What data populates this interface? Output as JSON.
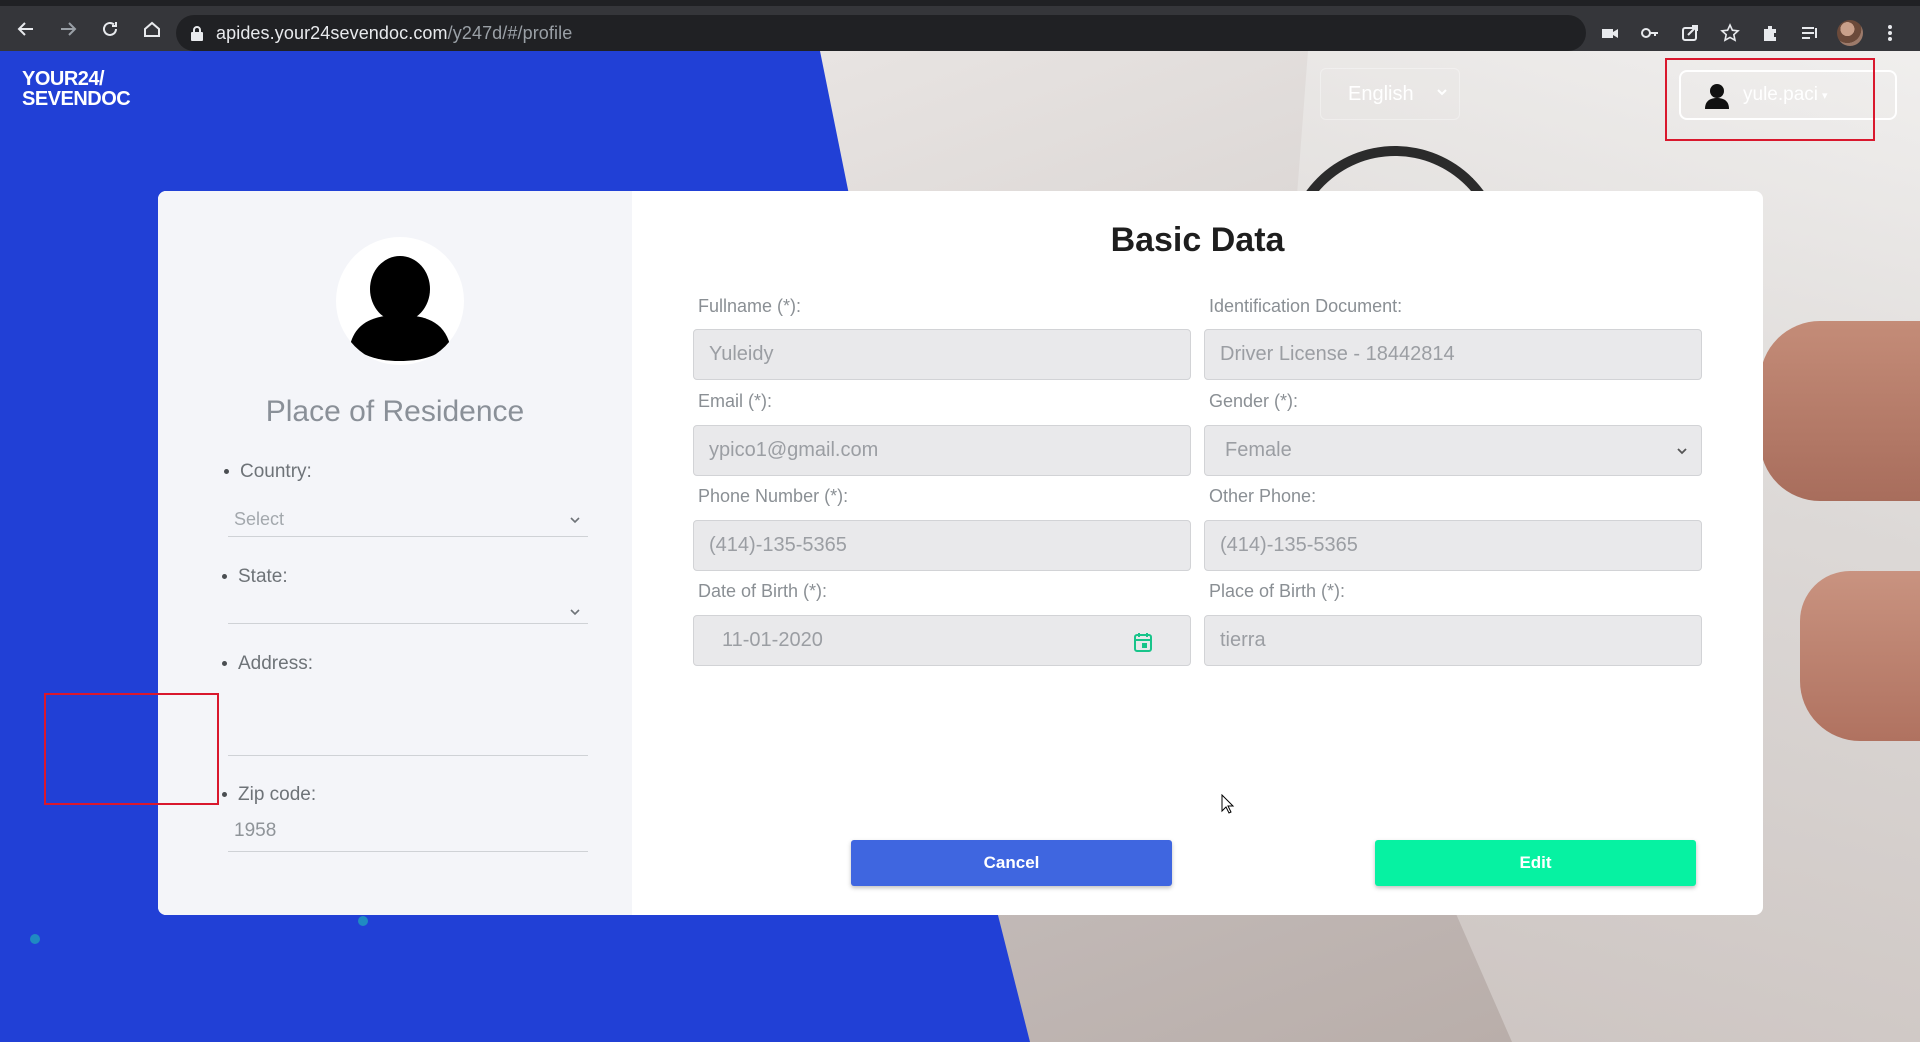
{
  "browser": {
    "url_domain": "apides.your24sevendoc.com",
    "url_path": "/y247d/#/profile"
  },
  "header": {
    "logo_line1": "YOUR24/",
    "logo_line2": "SEVENDOC",
    "language": "English",
    "username": "yule.paci"
  },
  "residence": {
    "title": "Place of Residence",
    "country_label": "Country:",
    "country_value": "Select",
    "state_label": "State:",
    "state_value": "",
    "address_label": "Address:",
    "address_value": "",
    "zip_label": "Zip code:",
    "zip_value": "1958"
  },
  "basic": {
    "title": "Basic Data",
    "fullname_label": "Fullname (*):",
    "fullname_value": "Yuleidy",
    "id_label": "Identification Document:",
    "id_value": "Driver License - 18442814",
    "email_label": "Email (*):",
    "email_value": "ypico1@gmail.com",
    "gender_label": "Gender (*):",
    "gender_value": "Female",
    "phone_label": "Phone Number (*):",
    "phone_value": "(414)-135-5365",
    "other_phone_label": "Other Phone:",
    "other_phone_value": "(414)-135-5365",
    "dob_label": "Date of Birth (*):",
    "dob_value": "11-01-2020",
    "pob_label": "Place of Birth (*):",
    "pob_value": "tierra"
  },
  "actions": {
    "cancel": "Cancel",
    "edit": "Edit"
  },
  "colors": {
    "brand_blue": "#2140d6",
    "edit_green": "#06f2a2",
    "cancel_blue": "#3f66e0",
    "highlight_red": "#d9182d"
  }
}
